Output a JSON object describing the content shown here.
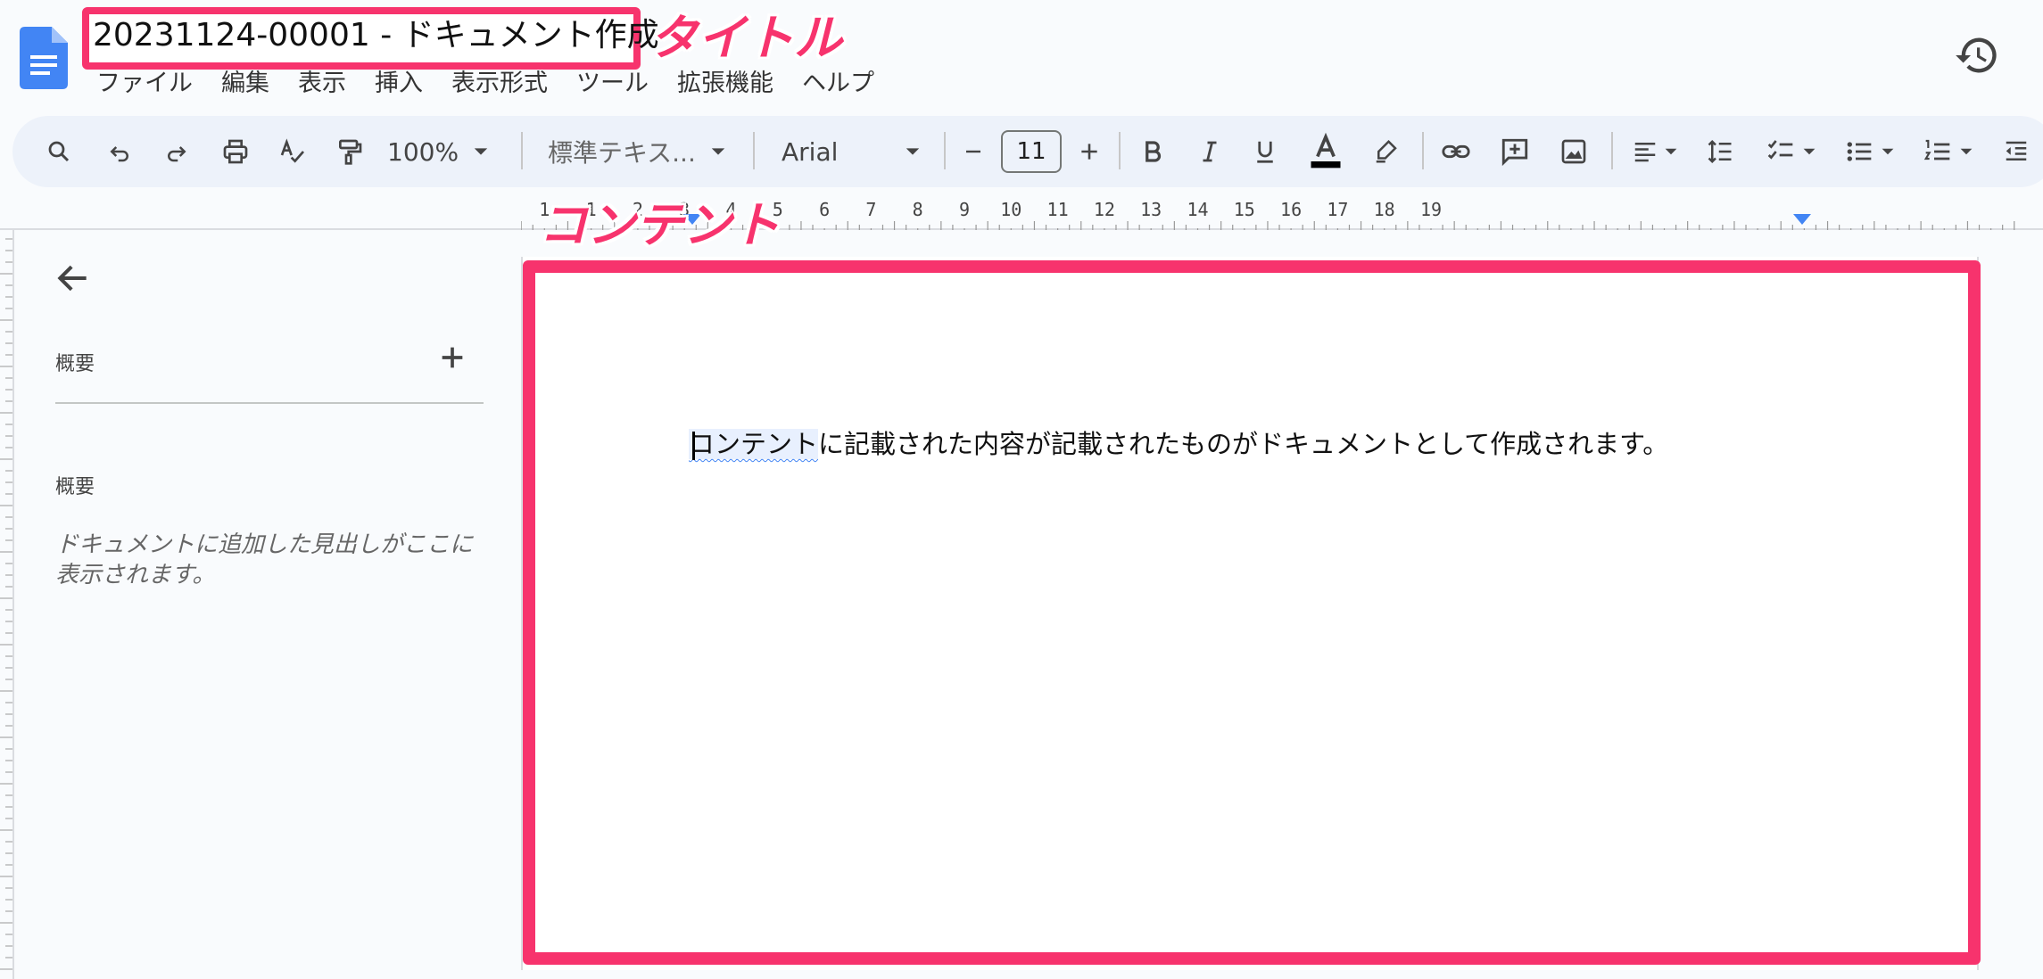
{
  "document": {
    "title": "20231124-00001 - ドキュメント作成"
  },
  "annotations": {
    "title_callout": "タイトル",
    "content_callout": "コンテント"
  },
  "menu": [
    "ファイル",
    "編集",
    "表示",
    "挿入",
    "表示形式",
    "ツール",
    "拡張機能",
    "ヘルプ"
  ],
  "toolbar": {
    "zoom": "100%",
    "style": "標準テキス...",
    "font": "Arial",
    "font_size": "11"
  },
  "ruler": {
    "marks": [
      "1",
      "1",
      "2",
      "3",
      "4",
      "5",
      "6",
      "7",
      "8",
      "9",
      "10",
      "11",
      "12",
      "13",
      "14",
      "15",
      "16",
      "17",
      "18",
      "19"
    ]
  },
  "outline": {
    "header": "概要",
    "section_label": "概要",
    "hint": "ドキュメントに追加した見出しがここに表示されます。"
  },
  "body": {
    "highlighted": "コンテント",
    "rest": "に記載された内容が記載されたものがドキュメントとして作成されます。"
  },
  "colors": {
    "annotation": "#f7336d",
    "docs_blue": "#4285f4",
    "toolbar_bg": "#edf2fa"
  },
  "icons": [
    "docs-logo-icon",
    "history-icon",
    "search-icon",
    "undo-icon",
    "redo-icon",
    "print-icon",
    "spellcheck-icon",
    "paint-format-icon",
    "chevron-down-icon",
    "minus-icon",
    "plus-icon",
    "bold-icon",
    "italic-icon",
    "underline-icon",
    "text-color-icon",
    "highlight-icon",
    "link-icon",
    "add-comment-icon",
    "image-icon",
    "align-left-icon",
    "line-spacing-icon",
    "checklist-icon",
    "bullet-list-icon",
    "numbered-list-icon",
    "decrease-indent-icon",
    "back-arrow-icon",
    "add-icon"
  ]
}
